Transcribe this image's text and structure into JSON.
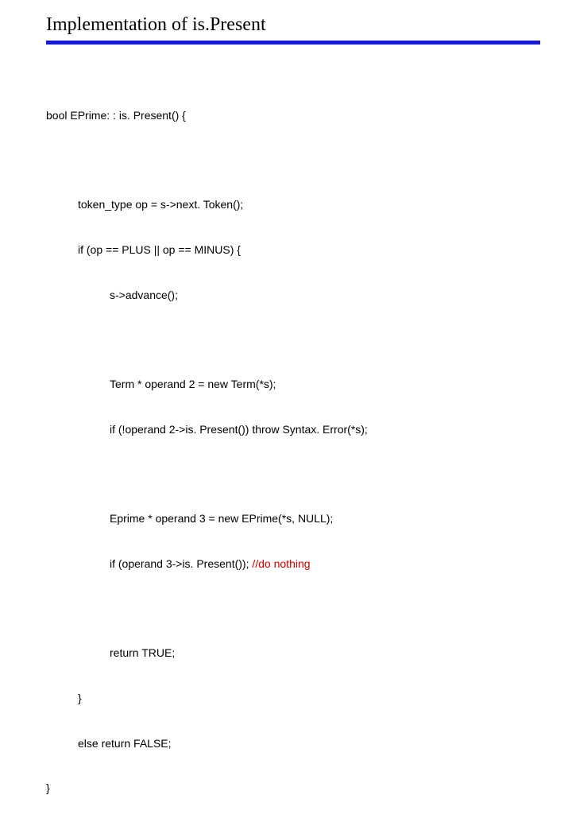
{
  "title": "Implementation of  is.Present",
  "code": {
    "l1": "bool EPrime: : is. Present() {",
    "l2": "token_type op = s->next. Token();",
    "l3": "if (op == PLUS || op == MINUS) {",
    "l4": "s->advance();",
    "l5": "Term * operand 2 = new Term(*s);",
    "l6": "if (!operand 2->is. Present()) throw Syntax. Error(*s);",
    "l7": "Eprime * operand 3 = new EPrime(*s, NULL);",
    "l8a": "if (operand 3->is. Present()); ",
    "l8b": "//do nothing",
    "l9": "return TRUE;",
    "l10": "}",
    "l11": "else return FALSE;",
    "l12": "}"
  }
}
